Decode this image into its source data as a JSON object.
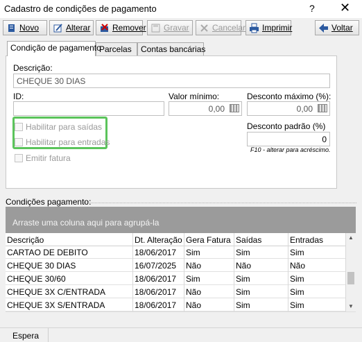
{
  "window": {
    "title": "Cadastro de condições de pagamento",
    "help": "?",
    "close": "✕"
  },
  "toolbar": {
    "novo": "Novo",
    "alterar": "Alterar",
    "remover": "Remover",
    "gravar": "Gravar",
    "cancelar": "Cancelar",
    "imprimir": "Imprimir",
    "voltar": "Voltar"
  },
  "tabs": [
    "Condição de pagamento",
    "Parcelas",
    "Contas bancárias"
  ],
  "form": {
    "descricao_label": "Descrição:",
    "descricao_value": "CHEQUE 30 DIAS",
    "id_label": "ID:",
    "id_value": "",
    "valor_minimo_label": "Valor mínimo:",
    "valor_minimo_value": "0,00",
    "desconto_maximo_label": "Desconto máximo (%):",
    "desconto_maximo_value": "0,00",
    "habilitar_saidas": "Habilitar para saídas",
    "habilitar_entradas": "Habilitar para entradas",
    "emitir_fatura": "Emitir fatura",
    "desconto_padrao_label": "Desconto padrão (%)",
    "desconto_padrao_value": "0",
    "hint": "F10 - alterar para acréscimo."
  },
  "grid": {
    "caption": "Condições pagamento:",
    "group_hint": "Arraste uma coluna aqui para agrupá-la",
    "columns": [
      "Descrição",
      "Dt. Alteração",
      "Gera Fatura",
      "Saídas",
      "Entradas"
    ],
    "rows": [
      [
        "CARTAO DE DEBITO",
        "18/06/2017",
        "Sim",
        "Sim",
        "Sim"
      ],
      [
        "CHEQUE 30 DIAS",
        "16/07/2025",
        "Não",
        "Não",
        "Não"
      ],
      [
        "CHEQUE 30/60",
        "18/06/2017",
        "Sim",
        "Sim",
        "Sim"
      ],
      [
        "CHEQUE 3X C/ENTRADA",
        "18/06/2017",
        "Não",
        "Sim",
        "Sim"
      ],
      [
        "CHEQUE 3X S/ENTRADA",
        "18/06/2017",
        "Não",
        "Sim",
        "Sim"
      ]
    ]
  },
  "status": {
    "text": "Espera"
  },
  "colors": {
    "highlight": "#5bc45b",
    "group_area": "#9b9b9b",
    "background": "#f0f0f0"
  }
}
